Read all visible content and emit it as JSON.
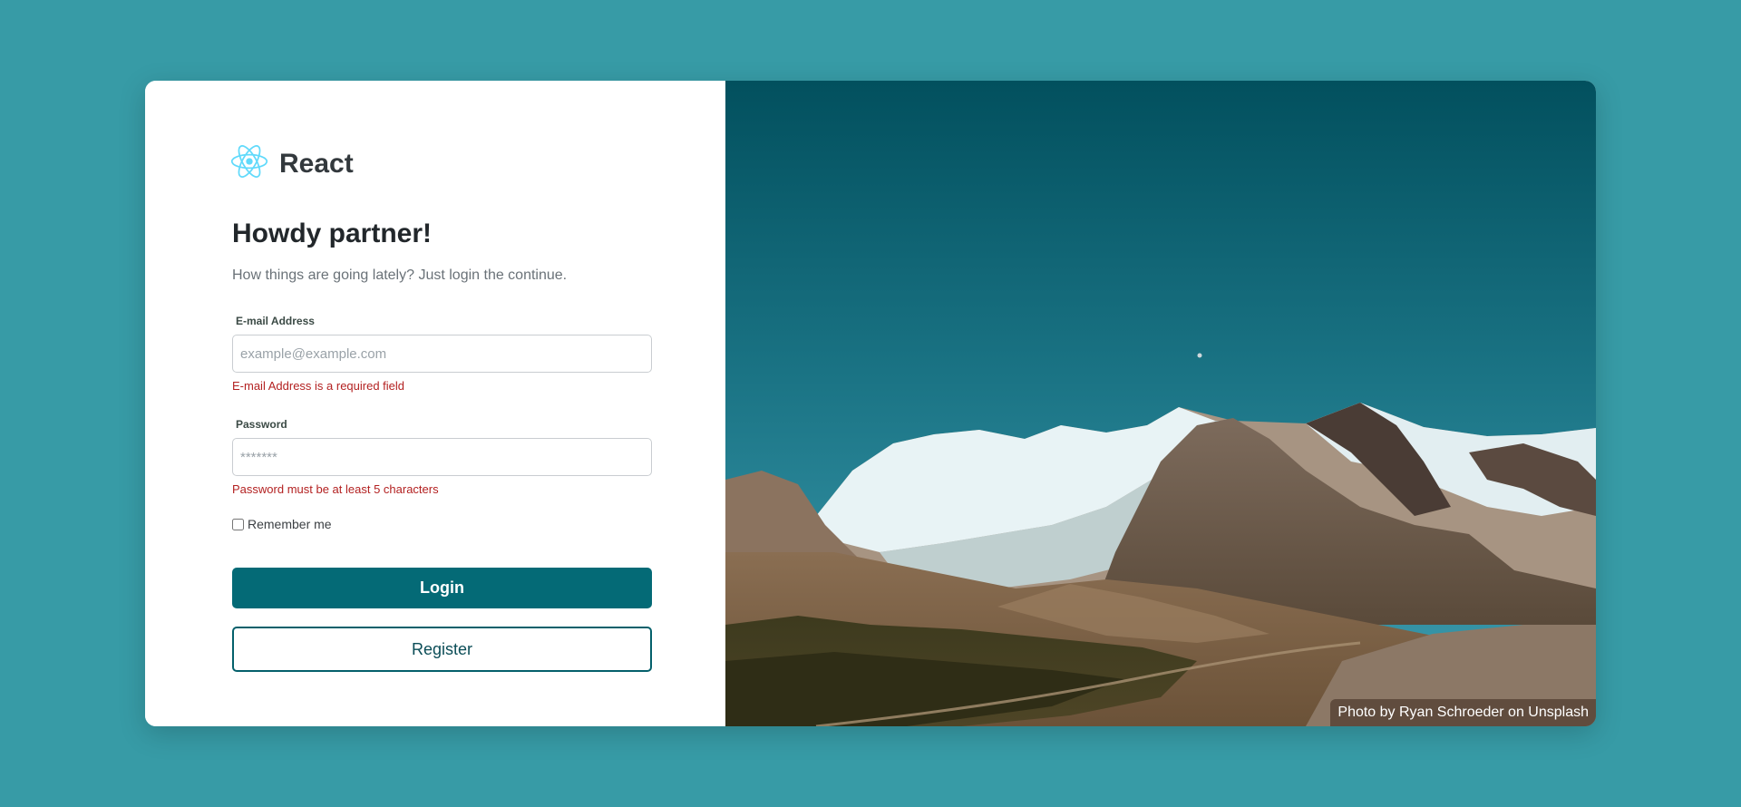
{
  "brand": {
    "name": "React",
    "icon": "react-logo-icon",
    "color": "#61dafb"
  },
  "form": {
    "title": "Howdy partner!",
    "subtitle": "How things are going lately? Just login the continue.",
    "email": {
      "label": "E-mail Address",
      "placeholder": "example@example.com",
      "value": "",
      "error": "E-mail Address is a required field"
    },
    "password": {
      "label": "Password",
      "placeholder": "*******",
      "value": "",
      "error": "Password must be at least 5 characters"
    },
    "remember": {
      "label": "Remember me",
      "checked": false
    },
    "login_label": "Login",
    "register_label": "Register"
  },
  "hero": {
    "credit": "Photo by Ryan Schroeder on Unsplash"
  },
  "colors": {
    "background": "#379ba6",
    "primary": "#046a76",
    "error": "#b32121"
  }
}
